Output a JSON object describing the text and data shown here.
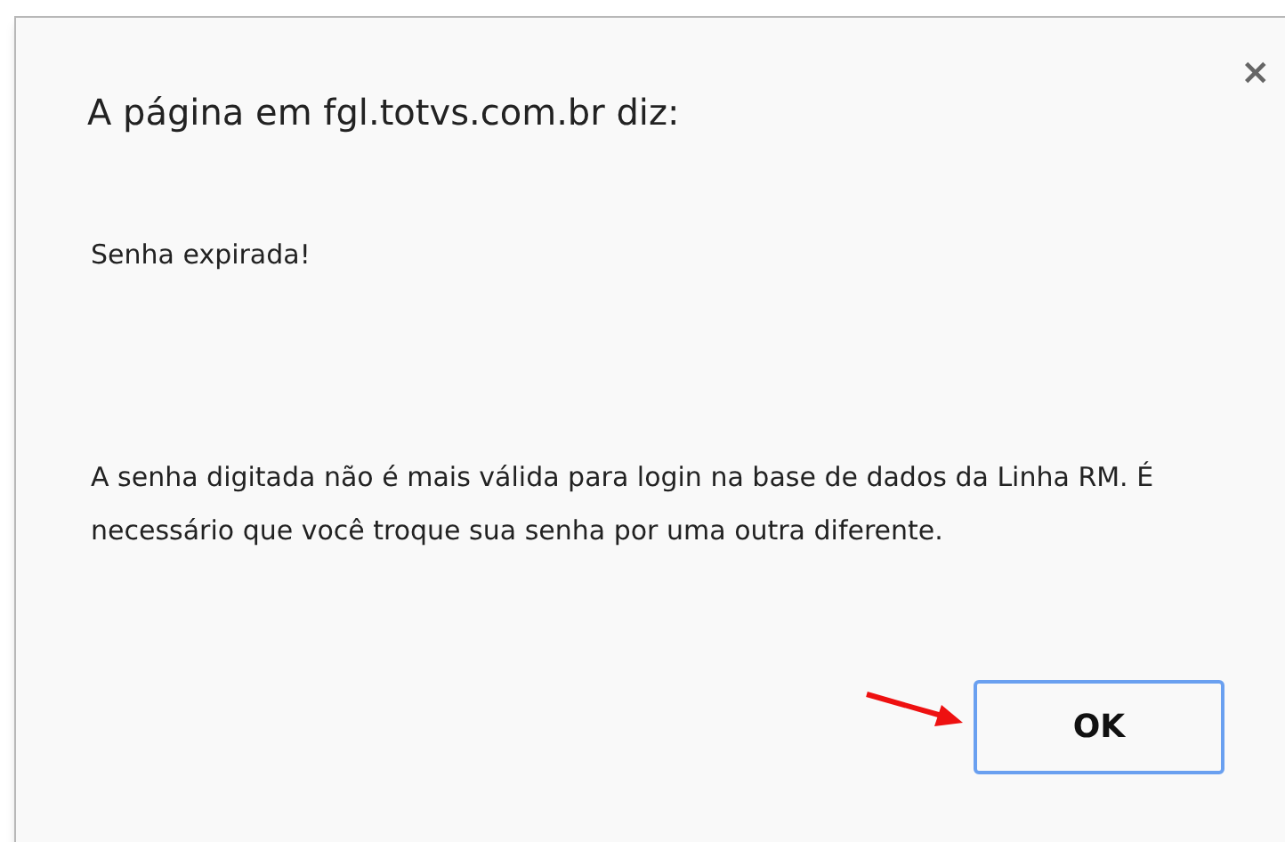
{
  "dialog": {
    "title": "A página em fgl.totvs.com.br diz:",
    "close": "×",
    "message": "Senha expirada!",
    "detail": "A senha digitada não é mais válida para login na base de dados da Linha RM. É necessário que você troque sua senha por uma outra diferente.",
    "buttons": [
      {
        "label": "OK"
      }
    ]
  }
}
